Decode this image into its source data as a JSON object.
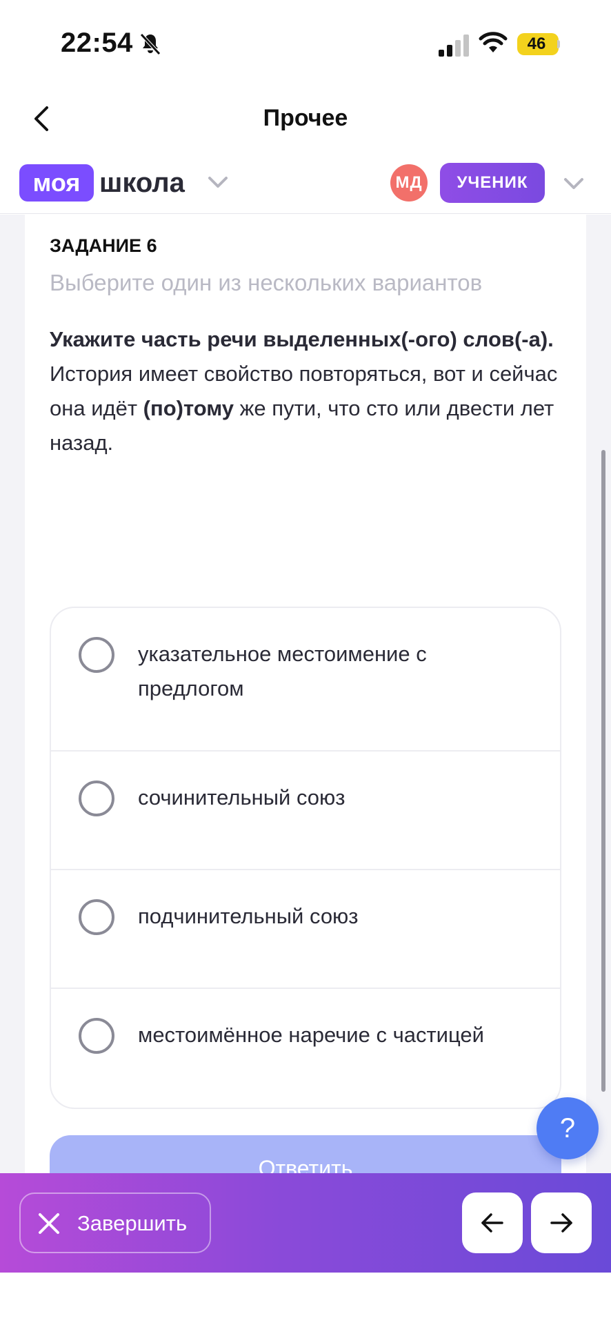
{
  "status_bar": {
    "time": "22:54",
    "battery": "46",
    "icons": [
      "bell-off-icon",
      "signal-icon",
      "wifi-icon",
      "battery-icon"
    ]
  },
  "nav": {
    "title": "Прочее"
  },
  "brand": {
    "logo_part1": "моя",
    "logo_part2": "школа",
    "avatar_initials": "МД",
    "role": "УЧЕНИК",
    "accent_color": "#7b4dff"
  },
  "task": {
    "label": "ЗАДАНИЕ 6",
    "hint": "Выберите один из нескольких вариантов",
    "question_title": "Укажите часть речи выделенных(-ого) слов(-а).",
    "question_text_before": "История имеет свойство повторяться, вот и сейчас она идёт ",
    "question_highlight": "(по)тому",
    "question_text_after": " же пути, что сто или двести лет назад."
  },
  "options": [
    {
      "label": "указательное местоимение с предлогом",
      "selected": false
    },
    {
      "label": "сочинительный союз",
      "selected": false
    },
    {
      "label": "подчинительный союз",
      "selected": false
    },
    {
      "label": "местоимённое наречие с частицей",
      "selected": false
    }
  ],
  "answer_button": "Ответить",
  "help_button": "?",
  "bottom_bar": {
    "finish_label": "Завершить",
    "prev_icon": "arrow-left-icon",
    "next_icon": "arrow-right-icon"
  }
}
